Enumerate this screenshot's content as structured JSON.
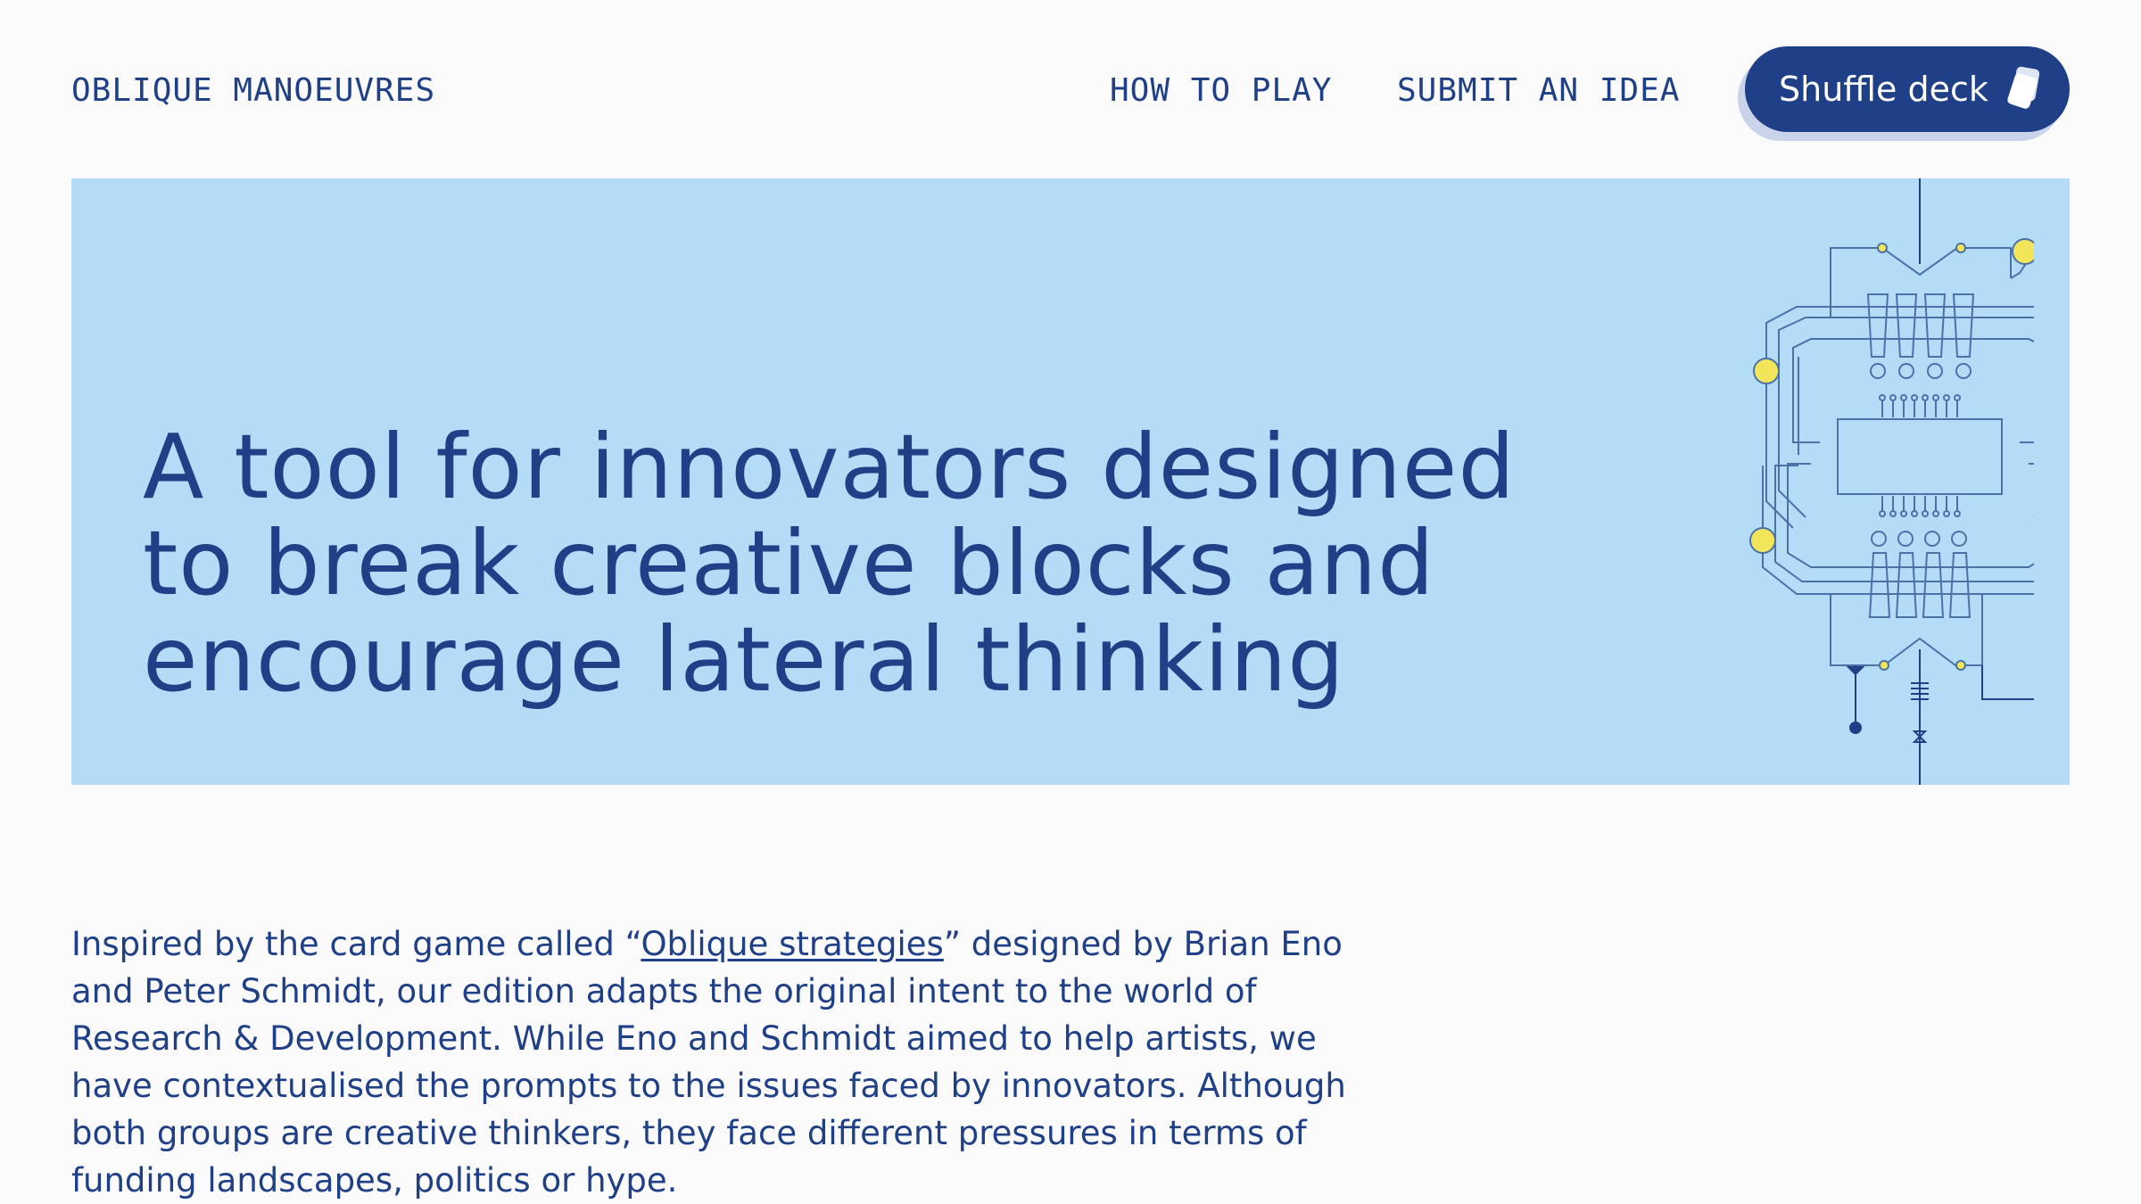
{
  "header": {
    "brand": "OBLIQUE MANOEUVRES",
    "nav": [
      {
        "label": "HOW TO PLAY"
      },
      {
        "label": "SUBMIT AN IDEA"
      }
    ],
    "shuffle_button": {
      "label": "Shuffle deck",
      "icon": "cards-icon"
    }
  },
  "hero": {
    "title_lines": [
      "A tool for innovators designed",
      "to break creative blocks and",
      "encourage lateral thinking"
    ],
    "illustration_icon": "circuit-board-illustration"
  },
  "intro": {
    "before_link": "Inspired by the card game called “",
    "link_text": "Oblique strategies",
    "after_link": "” designed by Brian Eno and Peter Schmidt, our edition adapts the original intent to the world of Research & Development. While Eno and Schmidt aimed to help artists, we have contextualised the prompts to the issues faced by innovators. Although both groups are creative thinkers, they face different pressures in terms of funding landscapes, politics or hype."
  },
  "colors": {
    "primary": "#1f3f86",
    "hero_background": "#b3ddf7",
    "page_background": "#fafafa",
    "accent_yellow": "#f2e55a",
    "circuit_line": "#4a72a8"
  }
}
